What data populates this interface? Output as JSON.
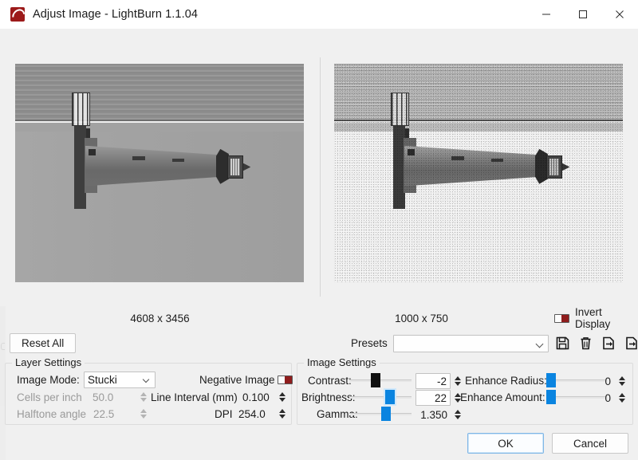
{
  "window": {
    "title": "Adjust Image - LightBurn 1.1.04",
    "app_icon": "lightburn-flame-icon",
    "minimize_label": "–",
    "maximize_label": "□",
    "close_label": "✕",
    "accent_color": "#0a84e0",
    "brand_color": "#9c1a1a"
  },
  "previews": {
    "original": {
      "caption": "4608 x 3456",
      "alt": "grayscale photo of a lighthouse on a pier, rotated 90 degrees"
    },
    "processed": {
      "caption": "1000 x 750",
      "alt": "Stucki-dithered preview of the lighthouse photo"
    },
    "invert_display": {
      "label": "Invert Display",
      "enabled": false,
      "toggle_color": "#8f1d1d"
    }
  },
  "toolbar": {
    "reset_all_label": "Reset All",
    "presets_label": "Presets",
    "presets_value": "",
    "presets_placeholder": "",
    "icons": [
      {
        "name": "save-preset-icon",
        "glyph": "floppy-disk"
      },
      {
        "name": "delete-preset-icon",
        "glyph": "trash-can"
      },
      {
        "name": "import-preset-icon",
        "glyph": "file-import"
      },
      {
        "name": "export-preset-icon",
        "glyph": "file-export"
      }
    ]
  },
  "layer_settings": {
    "title": "Layer Settings",
    "image_mode": {
      "label": "Image Mode:",
      "value": "Stucki"
    },
    "negative_image": {
      "label": "Negative Image",
      "enabled": false
    },
    "cells_per_inch": {
      "label": "Cells per inch",
      "value": "50.0",
      "disabled": true
    },
    "line_interval": {
      "label": "Line Interval (mm)",
      "value": "0.100",
      "disabled": false
    },
    "halftone_angle": {
      "label": "Halftone angle",
      "value": "22.5",
      "disabled": true
    },
    "dpi": {
      "label": "DPI",
      "value": "254.0",
      "disabled": false
    }
  },
  "image_settings": {
    "title": "Image Settings",
    "contrast": {
      "label": "Contrast:",
      "value": "-2",
      "slider_pct": 36,
      "handle_color": "#101010"
    },
    "brightness": {
      "label": "Brightness:",
      "value": "22",
      "slider_pct": 61,
      "handle_color": "#0a84e0"
    },
    "gamma": {
      "label": "Gamma:",
      "value": "1.350",
      "slider_pct": 56,
      "handle_color": "#0a84e0"
    },
    "enhance_radius": {
      "label": "Enhance Radius:",
      "value": "0",
      "slider_pct": 0,
      "handle_color": "#0a84e0"
    },
    "enhance_amount": {
      "label": "Enhance Amount:",
      "value": "0",
      "slider_pct": 0,
      "handle_color": "#0a84e0"
    }
  },
  "dialog_buttons": {
    "ok_label": "OK",
    "cancel_label": "Cancel"
  }
}
